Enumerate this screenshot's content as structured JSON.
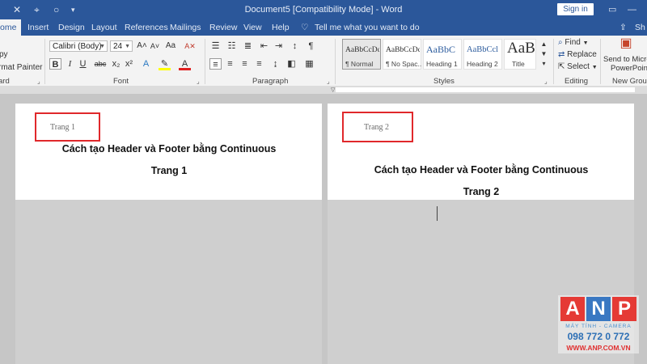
{
  "window": {
    "title": "Document5 [Compatibility Mode] - Word",
    "sign_in": "Sign in",
    "quick_access_icons": [
      "close-icon",
      "touch-mode-icon",
      "circle-icon",
      "customize-toolbar-icon"
    ]
  },
  "tabs": [
    {
      "label": "ome",
      "active": true
    },
    {
      "label": "Insert"
    },
    {
      "label": "Design"
    },
    {
      "label": "Layout"
    },
    {
      "label": "References"
    },
    {
      "label": "Mailings"
    },
    {
      "label": "Review"
    },
    {
      "label": "View"
    },
    {
      "label": "Help"
    }
  ],
  "tell_me": "Tell me what you want to do",
  "share_partial": "Sh",
  "ribbon": {
    "clipboard": {
      "copy": "py",
      "format_painter": "rmat Painter",
      "label": "ard"
    },
    "font": {
      "name": "Calibri (Body)",
      "size": "24",
      "label": "Font",
      "buttons": {
        "grow": "A˄",
        "shrink": "A˅",
        "case": "Aa",
        "clear": "A✕",
        "bold": "B",
        "italic": "I",
        "underline": "U",
        "strike": "abc",
        "sub": "x₂",
        "sup": "x²",
        "effects": "A",
        "highlight": "✎",
        "color": "A"
      }
    },
    "paragraph": {
      "label": "Paragraph",
      "pilcrow": "¶"
    },
    "styles": {
      "label": "Styles",
      "items": [
        {
          "preview": "AaBbCcDc",
          "name": "¶ Normal",
          "selected": true
        },
        {
          "preview": "AaBbCcDc",
          "name": "¶ No Spac..."
        },
        {
          "preview": "AaBbC",
          "name": "Heading 1"
        },
        {
          "preview": "AaBbCcl",
          "name": "Heading 2"
        },
        {
          "preview": "AaB",
          "name": "Title"
        }
      ]
    },
    "editing": {
      "find": "Find",
      "replace": "Replace",
      "select": "Select",
      "label": "Editing"
    },
    "new_group": {
      "send_line1": "Send to Microso",
      "send_line2": "PowerPoint",
      "label": "New Group"
    }
  },
  "pages": [
    {
      "header": "Trang 1",
      "title": "Cách tạo Header và Footer bằng Continuous",
      "body": "Trang 1"
    },
    {
      "header": "Trang 2",
      "title": "Cách tạo Header và Footer bằng Continuous",
      "body": "Trang 2"
    }
  ],
  "watermark": {
    "letters": [
      "A",
      "N",
      "P"
    ],
    "tagline": "MÁY TÍNH - CAMERA",
    "phone": "098 772 0 772",
    "website": "WWW.ANP.COM.VN"
  },
  "colors": {
    "word_blue": "#2b579a",
    "highlight_red": "#e0282b",
    "anp_red": "#e53a35",
    "anp_blue": "#3a78c2"
  }
}
